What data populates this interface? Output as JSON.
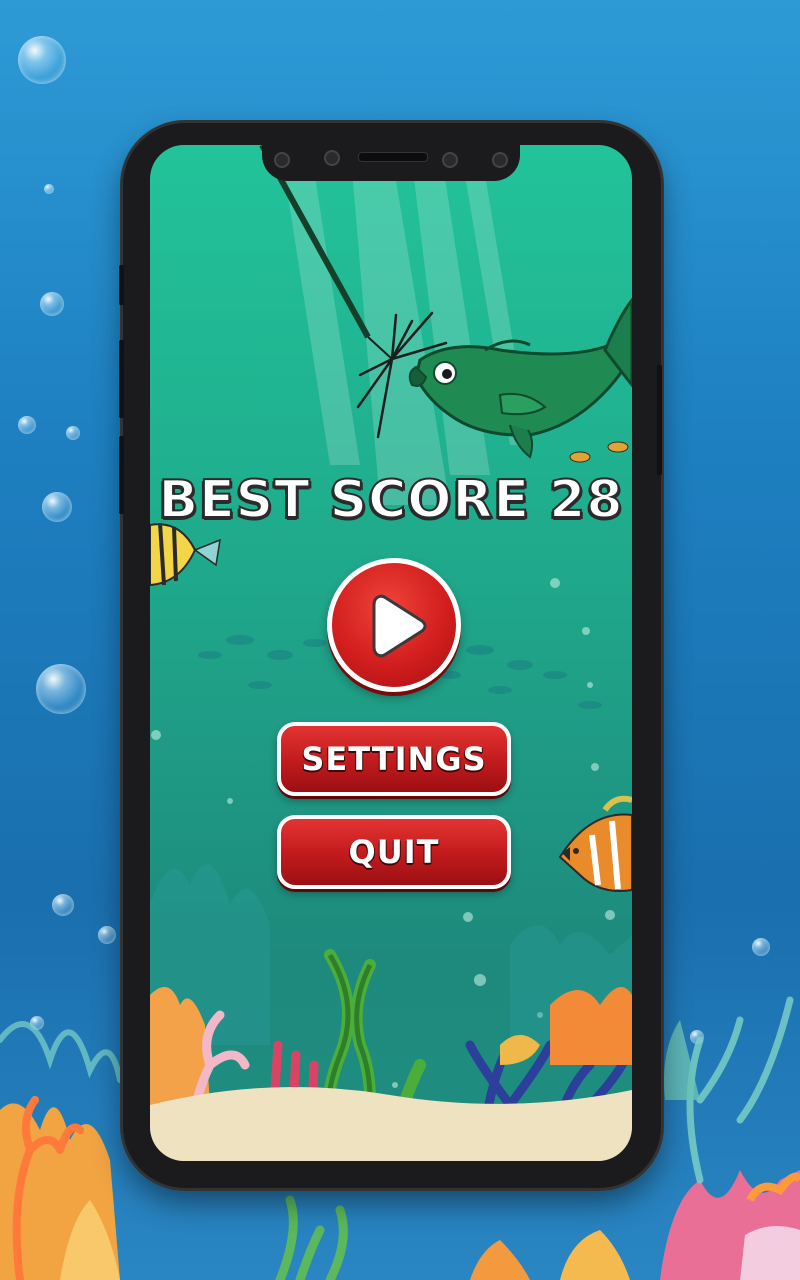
{
  "menu": {
    "best_score_label": "BEST SCORE",
    "best_score_value": "28",
    "play_icon": "play-triangle",
    "settings_label": "SETTINGS",
    "quit_label": "QUIT"
  },
  "colors": {
    "button_red": "#d21e1e",
    "screen_teal": "#1fae8e",
    "ocean_blue": "#1d7fc0"
  }
}
